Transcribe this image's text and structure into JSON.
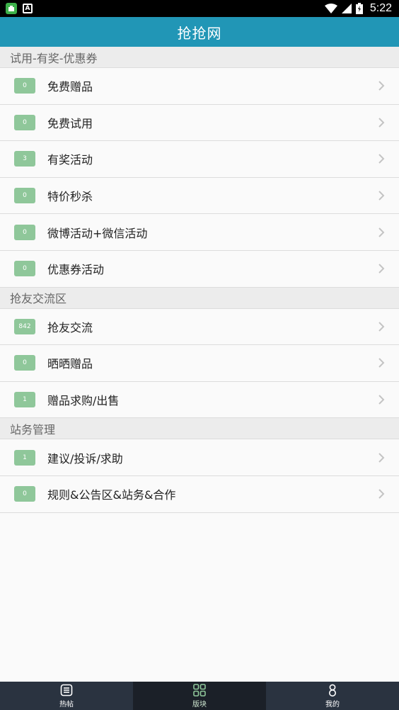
{
  "status_bar": {
    "time": "5:22"
  },
  "app_bar": {
    "title": "抢抢网"
  },
  "sections": [
    {
      "title": "试用-有奖-优惠券",
      "items": [
        {
          "count": "0",
          "label": "免费赠品"
        },
        {
          "count": "0",
          "label": "免费试用"
        },
        {
          "count": "3",
          "label": "有奖活动"
        },
        {
          "count": "0",
          "label": "特价秒杀"
        },
        {
          "count": "0",
          "label": "微博活动+微信活动"
        },
        {
          "count": "0",
          "label": "优惠券活动"
        }
      ]
    },
    {
      "title": "抢友交流区",
      "items": [
        {
          "count": "842",
          "label": "抢友交流"
        },
        {
          "count": "0",
          "label": "晒晒赠品"
        },
        {
          "count": "1",
          "label": "赠品求购/出售"
        }
      ]
    },
    {
      "title": "站务管理",
      "items": [
        {
          "count": "1",
          "label": "建议/投诉/求助"
        },
        {
          "count": "0",
          "label": "规则&公告区&站务&合作"
        }
      ]
    }
  ],
  "bottom_nav": [
    {
      "label": "热帖",
      "icon": "list-icon",
      "active": false
    },
    {
      "label": "版块",
      "icon": "grid-icon",
      "active": true
    },
    {
      "label": "我的",
      "icon": "user-icon",
      "active": false
    }
  ],
  "colors": {
    "app_bar": "#2196b6",
    "badge": "#8fc79a",
    "bottom_nav": "#2a3340",
    "bottom_nav_active": "#1b2028"
  }
}
